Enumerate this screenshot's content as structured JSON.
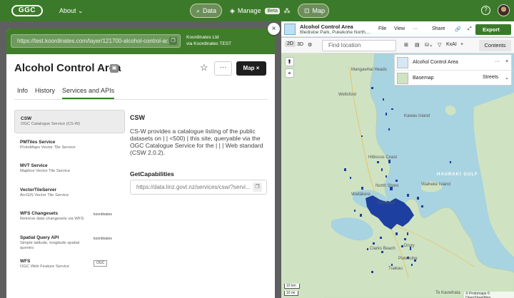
{
  "topbar": {
    "logo": "GGC",
    "about": "About",
    "nav": {
      "data": "Data",
      "manage": "Manage",
      "beta": "Beta",
      "map": "Map"
    },
    "help": "?"
  },
  "panel": {
    "url": "https://test.koordinates.com/layer/121700-alcohol-control-ar...",
    "publisher_line1": "Koordinates Ltd",
    "publisher_line2": "via Koordinates TEST",
    "title": "Alcohol Control Area",
    "map_button": "Map",
    "tabs": [
      "Info",
      "History",
      "Services and APIs"
    ],
    "services": [
      {
        "name": "CSW",
        "desc": "OGC Catalogue Service (CS-W)",
        "badge": ""
      },
      {
        "name": "PMTiles Service",
        "desc": "ProtoMaps Vector Tile Service",
        "badge": ""
      },
      {
        "name": "MVT Service",
        "desc": "Mapbox Vector Tile Service",
        "badge": ""
      },
      {
        "name": "VectorTileServer",
        "desc": "ArcGIS Vector Tile Service",
        "badge": ""
      },
      {
        "name": "WFS Changesets",
        "desc": "Retrieve data changesets via WFS",
        "badge": "koordinates"
      },
      {
        "name": "Spatial Query API",
        "desc": "Simple latitude, longitude spatial queries",
        "badge": "koordinates"
      },
      {
        "name": "WFS",
        "desc": "OGC Web Feature Service",
        "badge": "OGC"
      }
    ],
    "detail": {
      "title": "CSW",
      "description": "CS-W provides a catalogue listing of the public datasets on | | <500) | this site, queryable via the OGC Catalogue Service for the | | | Web standard (CSW 2.0.2).",
      "getcap_label": "GetCapabilities",
      "getcap_url": "https://data.linz.govt.nz/services/csw/?servi..."
    }
  },
  "map": {
    "title": "Alcohol Control Area",
    "subtitle": "Bledisloe Park, Pukekohe North,...",
    "menu": [
      "File",
      "View",
      "···",
      "Share"
    ],
    "export": "Export",
    "mode_2d": "2D",
    "mode_3d": "3D",
    "find_placeholder": "Find location",
    "kxai": "KxAI",
    "contents": "Contents",
    "layers": [
      {
        "name": "Alcohol Control Area",
        "control": "···"
      },
      {
        "name": "Basemap",
        "control": "Streets"
      }
    ],
    "places": [
      "Mangawhai Heads",
      "Wellsford",
      "Hibiscus Coast",
      "Waiheke Island",
      "North Shore",
      "Waitākere",
      "Auckland",
      "Clarks Beach",
      "Drury",
      "Pukekohe",
      "Te Kauwhata",
      "Tuakau",
      "Kawau Island"
    ],
    "sea_label": "HAURAKI GULF",
    "scale_km": "10 km",
    "scale_mi": "10 mi",
    "attribution": "© Protomaps © OpenStreetMap",
    "colors": {
      "feature": "#1d3f9f",
      "land": "#cfe3c3",
      "water": "#a8d3e0"
    }
  }
}
